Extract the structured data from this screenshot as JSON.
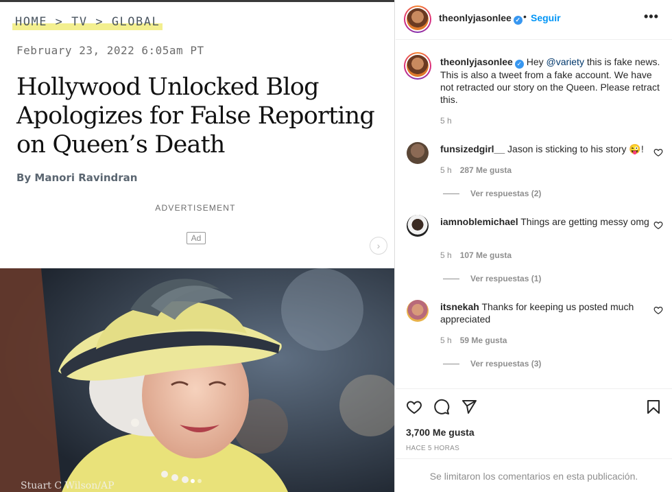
{
  "media": {
    "breadcrumb": "HOME > TV > GLOBAL",
    "date": "February 23, 2022 6:05am PT",
    "headline": "Hollywood Unlocked Blog Apologizes for False Reporting on Queen’s Death",
    "byline": "By Manori Ravindran",
    "ad_label": "ADVERTISEMENT",
    "ad_badge": "Ad",
    "photo_credit": "Stuart C Wilson/AP",
    "next_icon": "chevron-right-icon",
    "carousel": {
      "total": 2,
      "active": 1
    }
  },
  "header": {
    "username": "theonlyjasonlee",
    "verified_icon": "verified-badge-icon",
    "separator": "•",
    "follow_label": "Seguir",
    "more_icon": "more-horizontal-icon",
    "more_glyph": "•••"
  },
  "caption": {
    "username": "theonlyjasonlee",
    "text_before": "Hey ",
    "mention": "@variety",
    "text_after": " this is fake news. This is also a tweet from a fake account. We have not retracted our story on the Queen. Please retract this.",
    "time": "5 h"
  },
  "comments": [
    {
      "username": "funsizedgirl__",
      "text": "Jason is sticking to his story 😜!",
      "time": "5 h",
      "likes": "287 Me gusta",
      "replies": "Ver respuestas (2)"
    },
    {
      "username": "iamnoblemichael",
      "text": "Things are getting messy omg",
      "time": "5 h",
      "likes": "107 Me gusta",
      "replies": "Ver respuestas (1)"
    },
    {
      "username": "itsnekah",
      "text": "Thanks for keeping us posted much appreciated",
      "time": "5 h",
      "likes": "59 Me gusta",
      "replies": "Ver respuestas (3)"
    }
  ],
  "actions": {
    "like_icon": "heart-icon",
    "comment_icon": "comment-icon",
    "share_icon": "share-icon",
    "save_icon": "bookmark-icon",
    "likes_count": "3,700 Me gusta",
    "time_ago": "HACE 5 HORAS",
    "comments_limited": "Se limitaron los comentarios en esta publicación."
  },
  "colors": {
    "link": "#0095f6",
    "muted": "#8e8e8e",
    "text": "#262626",
    "highlight": "#f3ef8f"
  }
}
